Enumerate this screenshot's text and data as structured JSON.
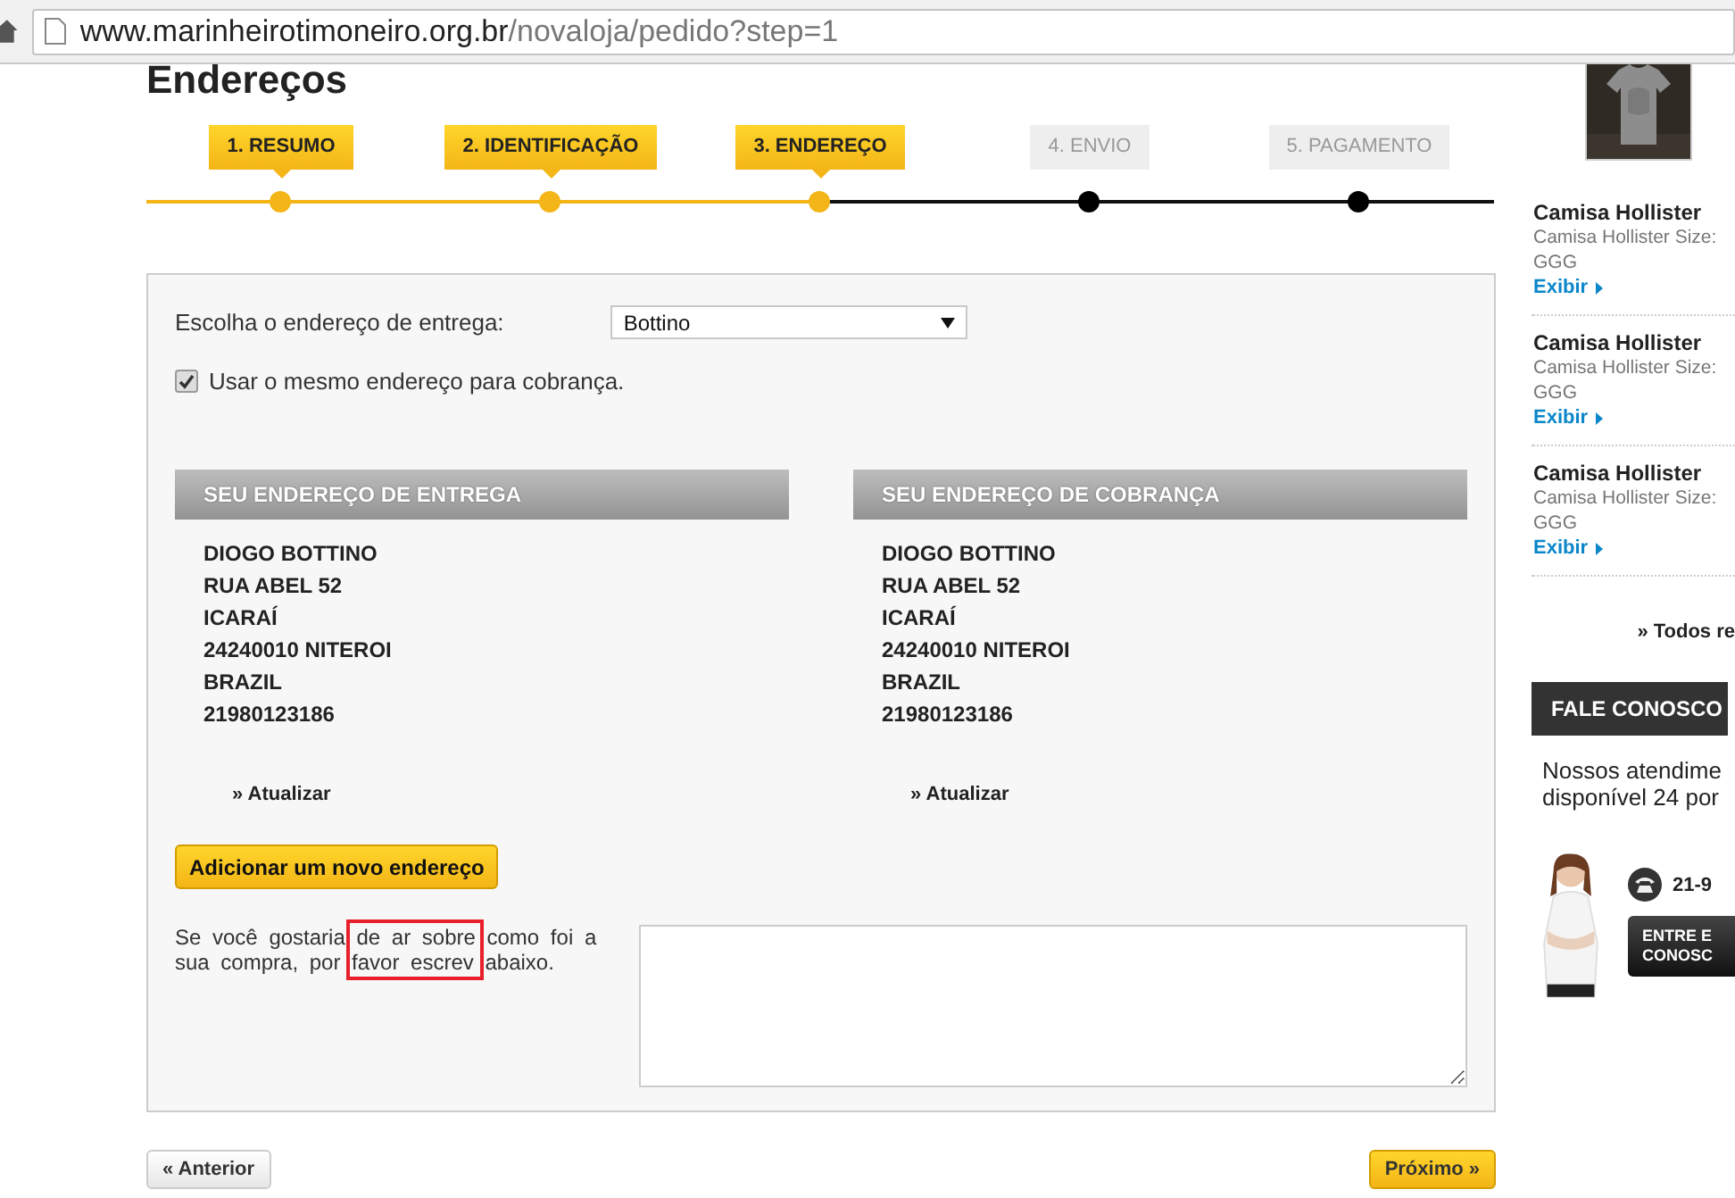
{
  "browser": {
    "url_host": "www.marinheirotimoneiro.org.br",
    "url_path": "/novaloja/pedido?step=1"
  },
  "page_title": "Endereços",
  "steps": [
    {
      "label": "1. RESUMO",
      "done": true
    },
    {
      "label": "2. IDENTIFICAÇÃO",
      "done": true
    },
    {
      "label": "3. ENDEREÇO",
      "done": true
    },
    {
      "label": "4. ENVIO",
      "done": false
    },
    {
      "label": "5. PAGAMENTO",
      "done": false
    }
  ],
  "delivery_select": {
    "label": "Escolha o endereço de entrega:",
    "value": "Bottino"
  },
  "same_billing": {
    "label": "Usar o mesmo endereço para cobrança.",
    "checked": true
  },
  "addresses": [
    {
      "heading": "SEU ENDEREÇO DE ENTREGA",
      "lines": [
        "DIOGO BOTTINO",
        "RUA ABEL 52",
        "ICARAÍ",
        "24240010 NITEROI",
        "BRAZIL",
        "21980123186"
      ],
      "link": "» Atualizar"
    },
    {
      "heading": "SEU ENDEREÇO DE COBRANÇA",
      "lines": [
        "DIOGO BOTTINO",
        "RUA ABEL 52",
        "ICARAÍ",
        "24240010 NITEROI",
        "BRAZIL",
        "21980123186"
      ],
      "link": "» Atualizar"
    }
  ],
  "add_button": "Adicionar um novo endereço",
  "comment": {
    "text": "Se você gostaria de ar sobre como foi a sua compra, por favor escrev abaixo.",
    "highlight": true
  },
  "nav": {
    "back": "« Anterior",
    "next": "Próximo »"
  },
  "sidebar": {
    "cart_items": [
      {
        "name": "Camisa Hollister",
        "detail": "Camisa Hollister Size:",
        "size": "GGG",
        "link": "Exibir"
      },
      {
        "name": "Camisa Hollister",
        "detail": "Camisa Hollister Size:",
        "size": "GGG",
        "link": "Exibir"
      },
      {
        "name": "Camisa Hollister",
        "detail": "Camisa Hollister Size:",
        "size": "GGG",
        "link": "Exibir"
      }
    ],
    "all_link": "» Todos re",
    "contact": {
      "heading": "FALE CONOSCO",
      "text_lines": [
        "Nossos atendime",
        "disponível 24 por"
      ],
      "phone": "21-9",
      "button_lines": [
        "ENTRE E",
        "CONOSC"
      ]
    }
  }
}
